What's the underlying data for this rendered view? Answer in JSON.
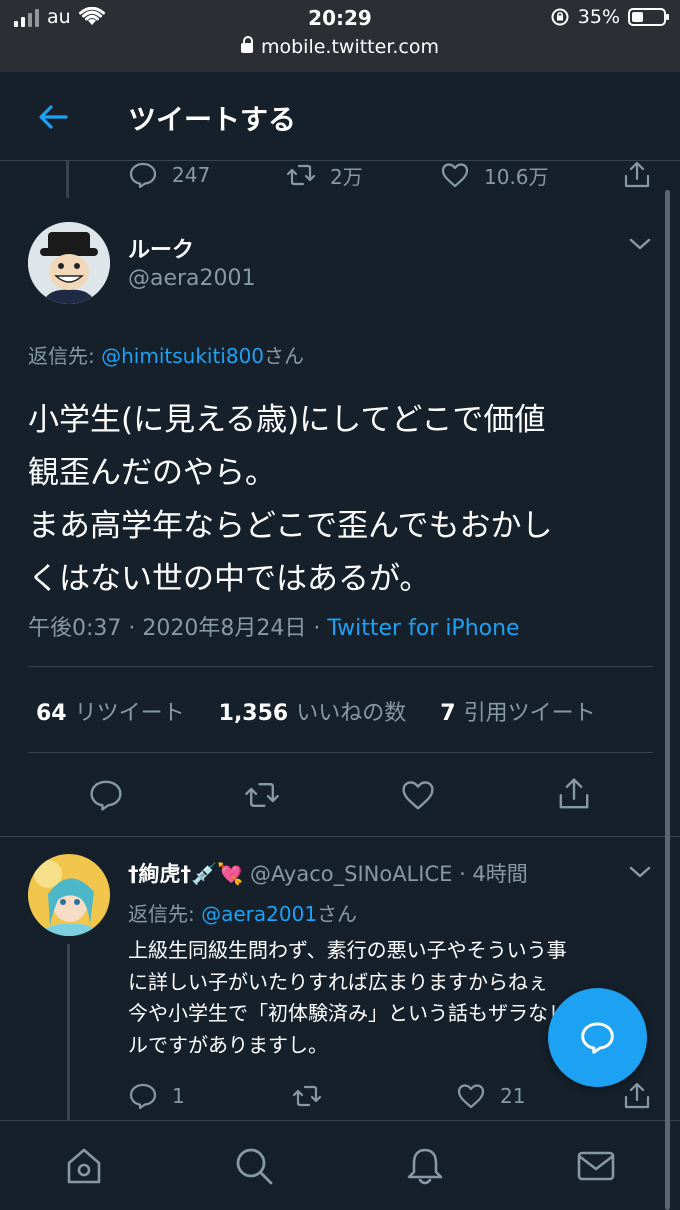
{
  "status_bar": {
    "carrier": "au",
    "time": "20:29",
    "battery": "35%",
    "battery_level": 0.35,
    "url": "mobile.twitter.com"
  },
  "header": {
    "title": "ツイートする"
  },
  "prev_tweet_actions": {
    "replies": "247",
    "retweets": "2万",
    "likes": "10.6万"
  },
  "tweet": {
    "display_name": "ルーク",
    "handle": "@aera2001",
    "reply_label": "返信先: ",
    "reply_to": "@himitsukiti800",
    "reply_suffix": "さん",
    "text_lines": [
      "小学生(に見える歳)にしてどこで価値",
      "観歪んだのやら。",
      "まあ高学年ならどこで歪んでもおかし",
      "くはない世の中ではあるが。"
    ],
    "timestamp": "午後0:37 · 2020年8月24日 · ",
    "source": "Twitter for iPhone",
    "stats": {
      "retweets_count": "64",
      "retweets_label": "リツイート",
      "likes_count": "1,356",
      "likes_label": "いいねの数",
      "quotes_count": "7",
      "quotes_label": "引用ツイート"
    }
  },
  "reply": {
    "display_name": "†絢虎†💉💘",
    "handle": "@Ayaco_SINoALICE",
    "time": " · 4時間",
    "reply_label": "返信先: ",
    "reply_to": "@aera2001",
    "reply_suffix": "さん",
    "text_lines": [
      "上級生同級生問わず、素行の悪い子やそういう事",
      "に詳しい子がいたりすれば広まりますからねぇ",
      "今や小学生で「初体験済み」という話もザラなレベ",
      "ルですがありますし。"
    ],
    "replies": "1",
    "likes": "21"
  },
  "colors": {
    "background": "#15202b",
    "accent": "#1da1f2",
    "muted": "#8899a6",
    "border": "#38444d"
  },
  "icons": {
    "back": "arrow-left-icon",
    "fab": "compose-reply-icon",
    "tabs": [
      "home-icon",
      "search-icon",
      "bell-icon",
      "mail-icon"
    ]
  }
}
